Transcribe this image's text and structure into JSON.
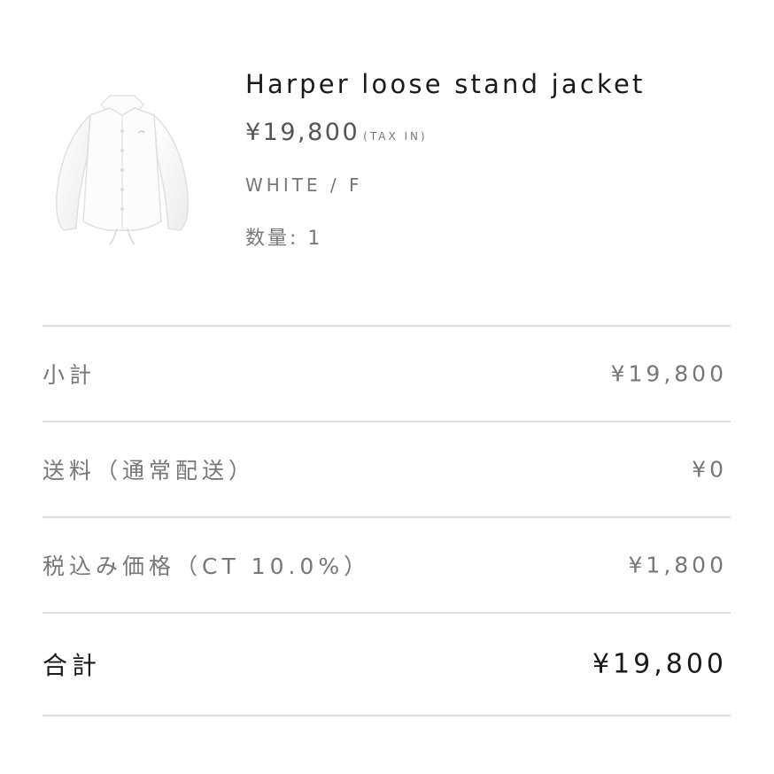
{
  "product": {
    "name": "Harper loose stand jacket",
    "price": "¥19,800",
    "tax_note": "(TAX IN)",
    "variant": "WHITE / F",
    "quantity": "数量: 1"
  },
  "summary": {
    "rows": [
      {
        "label": "小計",
        "value": "¥19,800"
      },
      {
        "label": "送料（通常配送）",
        "value": "¥0"
      },
      {
        "label": "税込み価格（CT 10.0%）",
        "value": "¥1,800"
      },
      {
        "label": "合計",
        "value": "¥19,800"
      }
    ]
  },
  "icons": {
    "product_image": "white-jacket-image"
  },
  "colors": {
    "text_dark": "#1a1a1a",
    "text_muted": "#777777",
    "divider": "#dddddd",
    "background": "#ffffff"
  }
}
